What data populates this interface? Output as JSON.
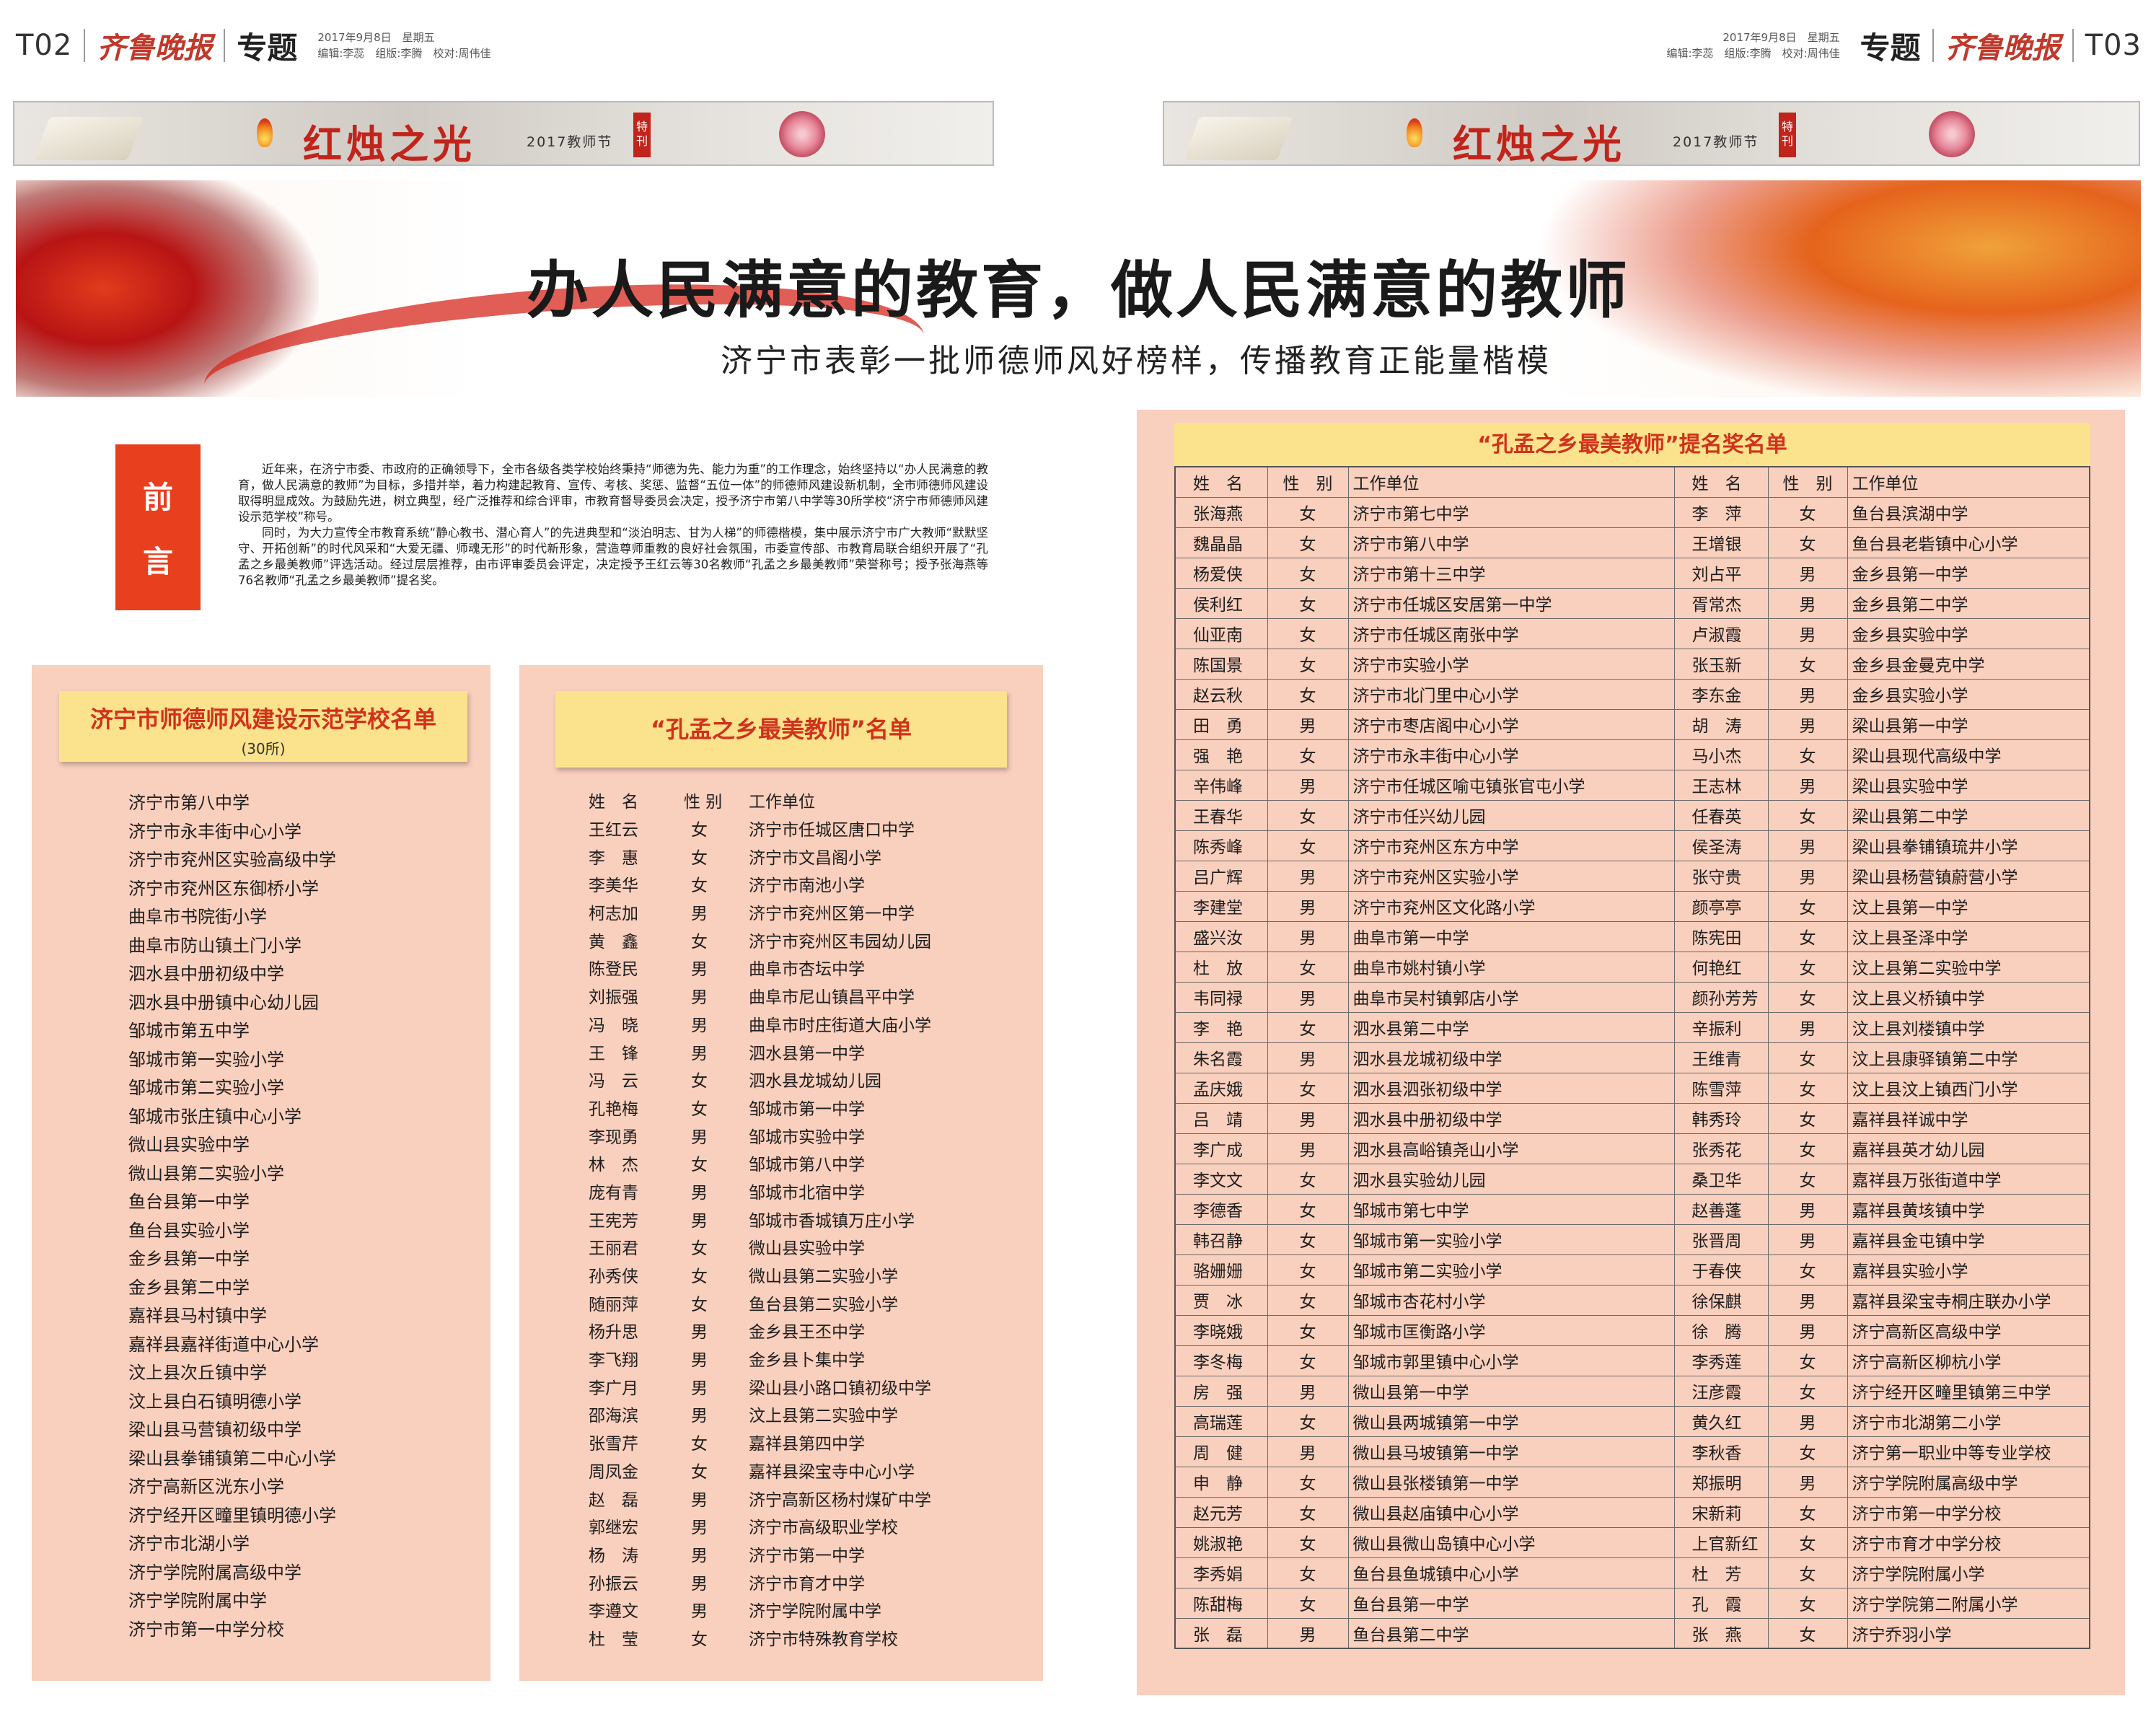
{
  "left_header": {
    "page": "T02",
    "paper": "齐鲁晚报",
    "section": "专题",
    "date": "2017年9月8日　星期五",
    "staff": "编辑:李蕊　组版:李腾　校对:周伟佳"
  },
  "right_header": {
    "page": "T03",
    "paper": "齐鲁晚报",
    "section": "专题",
    "date": "2017年9月8日　星期五",
    "staff": "编辑:李蕊　组版:李腾　校对:周伟佳"
  },
  "banner": {
    "title": "红烛之光",
    "year": "2017教师节",
    "special": "特刊"
  },
  "headline": "办人民满意的教育，做人民满意的教师",
  "subheadline": "济宁市表彰一批师德师风好榜样，传播教育正能量楷模",
  "preface": {
    "tag1": "前",
    "tag2": "言",
    "paragraphs": [
      "近年来，在济宁市委、市政府的正确领导下，全市各级各类学校始终秉持“师德为先、能力为重”的工作理念，始终坚持以“办人民满意的教育，做人民满意的教师”为目标，多措并举，着力构建起教育、宣传、考核、奖惩、监督“五位一体”的师德师风建设新机制，全市师德师风建设取得明显成效。为鼓励先进，树立典型，经广泛推荐和综合评审，市教育督导委员会决定，授予济宁市第八中学等30所学校“济宁市师德师风建设示范学校”称号。",
      "同时，为大力宣传全市教育系统“静心教书、潜心育人”的先进典型和“淡泊明志、甘为人梯”的师德楷模，集中展示济宁市广大教师“默默坚守、开拓创新”的时代风采和“大爱无疆、师魂无形”的时代新形象，营造尊师重教的良好社会氛围，市委宣传部、市教育局联合组织开展了“孔孟之乡最美教师”评选活动。经过层层推荐，由市评审委员会评定，决定授予王红云等30名教师“孔孟之乡最美教师”荣誉称号；授予张海燕等76名教师“孔孟之乡最美教师”提名奖。"
    ]
  },
  "schools": {
    "title": "济宁市师德师风建设示范学校名单",
    "count": "(30所)",
    "items": [
      "济宁市第八中学",
      "济宁市永丰街中心小学",
      "济宁市兖州区实验高级中学",
      "济宁市兖州区东御桥小学",
      "曲阜市书院街小学",
      "曲阜市防山镇土门小学",
      "泗水县中册初级中学",
      "泗水县中册镇中心幼儿园",
      "邹城市第五中学",
      "邹城市第一实验小学",
      "邹城市第二实验小学",
      "邹城市张庄镇中心小学",
      "微山县实验中学",
      "微山县第二实验小学",
      "鱼台县第一中学",
      "鱼台县实验小学",
      "金乡县第一中学",
      "金乡县第二中学",
      "嘉祥县马村镇中学",
      "嘉祥县嘉祥街道中心小学",
      "汶上县次丘镇中学",
      "汶上县白石镇明德小学",
      "梁山县马营镇初级中学",
      "梁山县拳铺镇第二中心小学",
      "济宁高新区洸东小学",
      "济宁经开区疃里镇明德小学",
      "济宁市北湖小学",
      "济宁学院附属高级中学",
      "济宁学院附属中学",
      "济宁市第一中学分校"
    ]
  },
  "teachers": {
    "title": "“孔孟之乡最美教师”名单",
    "headers": [
      "姓　名",
      "性 别",
      "工作单位"
    ],
    "rows": [
      [
        "王红云",
        "女",
        "济宁市任城区唐口中学"
      ],
      [
        "李　惠",
        "女",
        "济宁市文昌阁小学"
      ],
      [
        "李美华",
        "女",
        "济宁市南池小学"
      ],
      [
        "柯志加",
        "男",
        "济宁市兖州区第一中学"
      ],
      [
        "黄　鑫",
        "女",
        "济宁市兖州区韦园幼儿园"
      ],
      [
        "陈登民",
        "男",
        "曲阜市杏坛中学"
      ],
      [
        "刘振强",
        "男",
        "曲阜市尼山镇昌平中学"
      ],
      [
        "冯　晓",
        "男",
        "曲阜市时庄街道大庙小学"
      ],
      [
        "王　锋",
        "男",
        "泗水县第一中学"
      ],
      [
        "冯　云",
        "女",
        "泗水县龙城幼儿园"
      ],
      [
        "孔艳梅",
        "女",
        "邹城市第一中学"
      ],
      [
        "李现勇",
        "男",
        "邹城市实验中学"
      ],
      [
        "林　杰",
        "女",
        "邹城市第八中学"
      ],
      [
        "庞有青",
        "男",
        "邹城市北宿中学"
      ],
      [
        "王宪芳",
        "男",
        "邹城市香城镇万庄小学"
      ],
      [
        "王丽君",
        "女",
        "微山县实验中学"
      ],
      [
        "孙秀侠",
        "女",
        "微山县第二实验小学"
      ],
      [
        "随丽萍",
        "女",
        "鱼台县第二实验小学"
      ],
      [
        "杨升思",
        "男",
        "金乡县王丕中学"
      ],
      [
        "李飞翔",
        "男",
        "金乡县卜集中学"
      ],
      [
        "李广月",
        "男",
        "梁山县小路口镇初级中学"
      ],
      [
        "邵海滨",
        "男",
        "汶上县第二实验中学"
      ],
      [
        "张雪芹",
        "女",
        "嘉祥县第四中学"
      ],
      [
        "周凤金",
        "女",
        "嘉祥县梁宝寺中心小学"
      ],
      [
        "赵　磊",
        "男",
        "济宁高新区杨村煤矿中学"
      ],
      [
        "郭继宏",
        "男",
        "济宁市高级职业学校"
      ],
      [
        "杨　涛",
        "男",
        "济宁市第一中学"
      ],
      [
        "孙振云",
        "男",
        "济宁市育才中学"
      ],
      [
        "李遵文",
        "男",
        "济宁学院附属中学"
      ],
      [
        "杜　莹",
        "女",
        "济宁市特殊教育学校"
      ]
    ]
  },
  "nominees": {
    "title": "“孔孟之乡最美教师”提名奖名单",
    "headers": [
      "姓　名",
      "性　别",
      "工作单位",
      "姓　名",
      "性　别",
      "工作单位"
    ],
    "rows": [
      [
        "张海燕",
        "女",
        "济宁市第七中学",
        "李　萍",
        "女",
        "鱼台县滨湖中学"
      ],
      [
        "魏晶晶",
        "女",
        "济宁市第八中学",
        "王增银",
        "女",
        "鱼台县老砦镇中心小学"
      ],
      [
        "杨爱侠",
        "女",
        "济宁市第十三中学",
        "刘占平",
        "男",
        "金乡县第一中学"
      ],
      [
        "侯利红",
        "女",
        "济宁市任城区安居第一中学",
        "胥常杰",
        "男",
        "金乡县第二中学"
      ],
      [
        "仙亚南",
        "女",
        "济宁市任城区南张中学",
        "卢淑霞",
        "男",
        "金乡县实验中学"
      ],
      [
        "陈国景",
        "女",
        "济宁市实验小学",
        "张玉新",
        "女",
        "金乡县金曼克中学"
      ],
      [
        "赵云秋",
        "女",
        "济宁市北门里中心小学",
        "李东金",
        "男",
        "金乡县实验小学"
      ],
      [
        "田　勇",
        "男",
        "济宁市枣店阁中心小学",
        "胡　涛",
        "男",
        "梁山县第一中学"
      ],
      [
        "强　艳",
        "女",
        "济宁市永丰街中心小学",
        "马小杰",
        "女",
        "梁山县现代高级中学"
      ],
      [
        "辛伟峰",
        "男",
        "济宁市任城区喻屯镇张官屯小学",
        "王志林",
        "男",
        "梁山县实验中学"
      ],
      [
        "王春华",
        "女",
        "济宁市任兴幼儿园",
        "任春英",
        "女",
        "梁山县第二中学"
      ],
      [
        "陈秀峰",
        "女",
        "济宁市兖州区东方中学",
        "侯圣涛",
        "男",
        "梁山县拳铺镇琉井小学"
      ],
      [
        "吕广辉",
        "男",
        "济宁市兖州区实验小学",
        "张守贵",
        "男",
        "梁山县杨营镇蔚营小学"
      ],
      [
        "李建堂",
        "男",
        "济宁市兖州区文化路小学",
        "颜亭亭",
        "女",
        "汶上县第一中学"
      ],
      [
        "盛兴汝",
        "男",
        "曲阜市第一中学",
        "陈宪田",
        "女",
        "汶上县圣泽中学"
      ],
      [
        "杜　放",
        "女",
        "曲阜市姚村镇小学",
        "何艳红",
        "女",
        "汶上县第二实验中学"
      ],
      [
        "韦同禄",
        "男",
        "曲阜市吴村镇郭店小学",
        "颜孙芳芳",
        "女",
        "汶上县义桥镇中学"
      ],
      [
        "李　艳",
        "女",
        "泗水县第二中学",
        "辛振利",
        "男",
        "汶上县刘楼镇中学"
      ],
      [
        "朱名霞",
        "男",
        "泗水县龙城初级中学",
        "王维青",
        "女",
        "汶上县康驿镇第二中学"
      ],
      [
        "孟庆娥",
        "女",
        "泗水县泗张初级中学",
        "陈雪萍",
        "女",
        "汶上县汶上镇西门小学"
      ],
      [
        "吕　靖",
        "男",
        "泗水县中册初级中学",
        "韩秀玲",
        "女",
        "嘉祥县祥诚中学"
      ],
      [
        "李广成",
        "男",
        "泗水县高峪镇尧山小学",
        "张秀花",
        "女",
        "嘉祥县英才幼儿园"
      ],
      [
        "李文文",
        "女",
        "泗水县实验幼儿园",
        "桑卫华",
        "女",
        "嘉祥县万张街道中学"
      ],
      [
        "李德香",
        "女",
        "邹城市第七中学",
        "赵善蓬",
        "男",
        "嘉祥县黄垓镇中学"
      ],
      [
        "韩召静",
        "女",
        "邹城市第一实验小学",
        "张晋周",
        "男",
        "嘉祥县金屯镇中学"
      ],
      [
        "骆姗姗",
        "女",
        "邹城市第二实验小学",
        "于春侠",
        "女",
        "嘉祥县实验小学"
      ],
      [
        "贾　冰",
        "女",
        "邹城市杏花村小学",
        "徐保麒",
        "男",
        "嘉祥县梁宝寺桐庄联办小学"
      ],
      [
        "李晓娥",
        "女",
        "邹城市匡衡路小学",
        "徐　腾",
        "男",
        "济宁高新区高级中学"
      ],
      [
        "李冬梅",
        "女",
        "邹城市郭里镇中心小学",
        "李秀莲",
        "女",
        "济宁高新区柳杭小学"
      ],
      [
        "房　强",
        "男",
        "微山县第一中学",
        "汪彦霞",
        "女",
        "济宁经开区疃里镇第三中学"
      ],
      [
        "高瑞莲",
        "女",
        "微山县两城镇第一中学",
        "黄久红",
        "男",
        "济宁市北湖第二小学"
      ],
      [
        "周　健",
        "男",
        "微山县马坡镇第一中学",
        "李秋香",
        "女",
        "济宁第一职业中等专业学校"
      ],
      [
        "申　静",
        "女",
        "微山县张楼镇第一中学",
        "郑振明",
        "男",
        "济宁学院附属高级中学"
      ],
      [
        "赵元芳",
        "女",
        "微山县赵庙镇中心小学",
        "宋新莉",
        "女",
        "济宁市第一中学分校"
      ],
      [
        "姚淑艳",
        "女",
        "微山县微山岛镇中心小学",
        "上官新红",
        "女",
        "济宁市育才中学分校"
      ],
      [
        "李秀娟",
        "女",
        "鱼台县鱼城镇中心小学",
        "杜　芳",
        "女",
        "济宁学院附属小学"
      ],
      [
        "陈甜梅",
        "女",
        "鱼台县第一中学",
        "孔　霞",
        "女",
        "济宁学院第二附属小学"
      ],
      [
        "张　磊",
        "男",
        "鱼台县第二中学",
        "张　燕",
        "女",
        "济宁乔羽小学"
      ]
    ]
  }
}
